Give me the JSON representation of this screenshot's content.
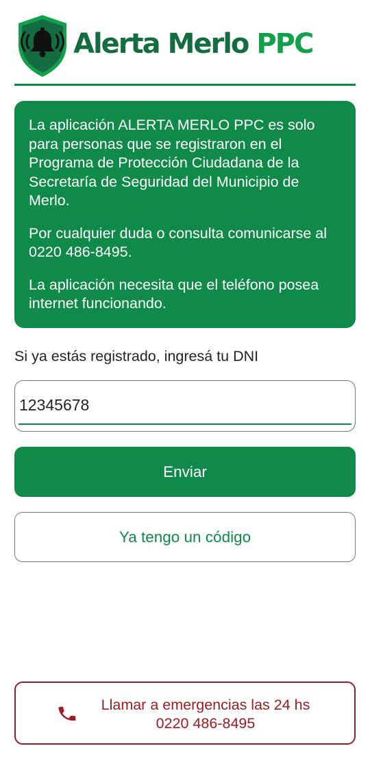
{
  "header": {
    "logo_icon": "shield-bell-icon",
    "title_main": "Alerta Merlo",
    "title_accent": "PPC",
    "brand_color": "#146d41",
    "accent_color": "#12a14b"
  },
  "info": {
    "paragraphs": [
      "La aplicación ALERTA MERLO PPC es solo para personas que se registraron en el Programa de Protección Ciudadana de la Secretaría de Seguridad del Municipio de Merlo.",
      "Por cualquier duda o consulta comunicarse al 0220 486-8495.",
      "La aplicación necesita que el teléfono posea internet funcionando."
    ],
    "background_color": "#0f8a49"
  },
  "form": {
    "dni_label": "Si ya estás registrado, ingresá tu DNI",
    "dni_value": "12345678",
    "send_label": "Enviar",
    "code_label": "Ya tengo un código"
  },
  "emergency": {
    "icon": "phone-icon",
    "line1": "Llamar a emergencias las 24 hs",
    "line2": "0220 486-8495",
    "color": "#9b1c22"
  }
}
